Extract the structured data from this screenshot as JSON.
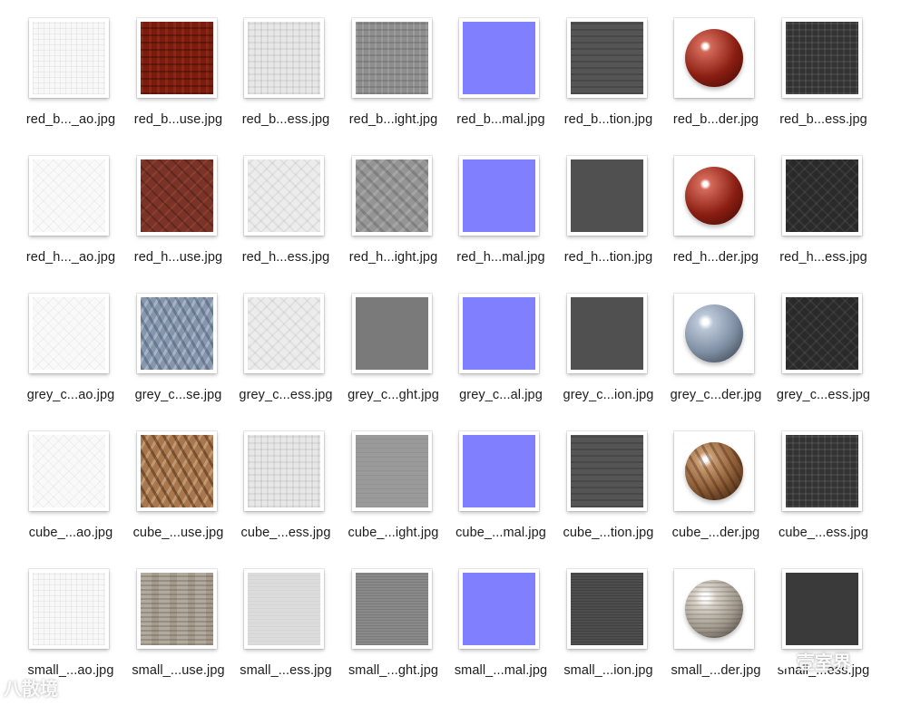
{
  "files": [
    {
      "name": "red_b..._ao.jpg",
      "texture": "ao"
    },
    {
      "name": "red_b...use.jpg",
      "texture": "basket-red"
    },
    {
      "name": "red_b...ess.jpg",
      "texture": "rough-light"
    },
    {
      "name": "red_b...ight.jpg",
      "texture": "height"
    },
    {
      "name": "red_b...mal.jpg",
      "texture": "normal"
    },
    {
      "name": "red_b...tion.jpg",
      "texture": "reflection"
    },
    {
      "name": "red_b...der.jpg",
      "texture": "render",
      "sphere": "sphere-red"
    },
    {
      "name": "red_b...ess.jpg",
      "texture": "gloss-dark"
    },
    {
      "name": "red_h..._ao.jpg",
      "texture": "ao herring"
    },
    {
      "name": "red_h...use.jpg",
      "texture": "herring-red"
    },
    {
      "name": "red_h...ess.jpg",
      "texture": "rough-light h"
    },
    {
      "name": "red_h...ight.jpg",
      "texture": "height h"
    },
    {
      "name": "red_h...mal.jpg",
      "texture": "normal"
    },
    {
      "name": "red_h...tion.jpg",
      "texture": "reflection flat"
    },
    {
      "name": "red_h...der.jpg",
      "texture": "render",
      "sphere": "sphere-red"
    },
    {
      "name": "red_h...ess.jpg",
      "texture": "gloss-dark h"
    },
    {
      "name": "grey_c...ao.jpg",
      "texture": "ao herring"
    },
    {
      "name": "grey_c...se.jpg",
      "texture": "herring-grey"
    },
    {
      "name": "grey_c...ess.jpg",
      "texture": "rough-light h"
    },
    {
      "name": "grey_c...ght.jpg",
      "texture": "height g"
    },
    {
      "name": "grey_c...al.jpg",
      "texture": "normal"
    },
    {
      "name": "grey_c...ion.jpg",
      "texture": "reflection flat"
    },
    {
      "name": "grey_c...der.jpg",
      "texture": "render",
      "sphere": "sphere-grey"
    },
    {
      "name": "grey_c...ess.jpg",
      "texture": "gloss-dark h"
    },
    {
      "name": "cube_...ao.jpg",
      "texture": "ao herring"
    },
    {
      "name": "cube_...use.jpg",
      "texture": "cube-wood"
    },
    {
      "name": "cube_...ess.jpg",
      "texture": "rough-light"
    },
    {
      "name": "cube_...ight.jpg",
      "texture": "height c"
    },
    {
      "name": "cube_...mal.jpg",
      "texture": "normal"
    },
    {
      "name": "cube_...tion.jpg",
      "texture": "reflection"
    },
    {
      "name": "cube_...der.jpg",
      "texture": "render",
      "sphere": "sphere-cube"
    },
    {
      "name": "cube_...ess.jpg",
      "texture": "gloss-dark"
    },
    {
      "name": "small_...ao.jpg",
      "texture": "ao"
    },
    {
      "name": "small_...use.jpg",
      "texture": "small-wood"
    },
    {
      "name": "small_...ess.jpg",
      "texture": "rough-light s"
    },
    {
      "name": "small_...ght.jpg",
      "texture": "height s"
    },
    {
      "name": "small_...mal.jpg",
      "texture": "normal"
    },
    {
      "name": "small_...ion.jpg",
      "texture": "reflection s"
    },
    {
      "name": "small_...der.jpg",
      "texture": "render",
      "sphere": "sphere-small"
    },
    {
      "name": "small_...ess.jpg",
      "texture": "gloss-dark s"
    }
  ],
  "watermark": {
    "left": "八散境",
    "right": "壹室界"
  },
  "colors": {
    "background": "#ffffff",
    "normal_map": "#8080ff",
    "label_text": "#1c1c1c"
  }
}
